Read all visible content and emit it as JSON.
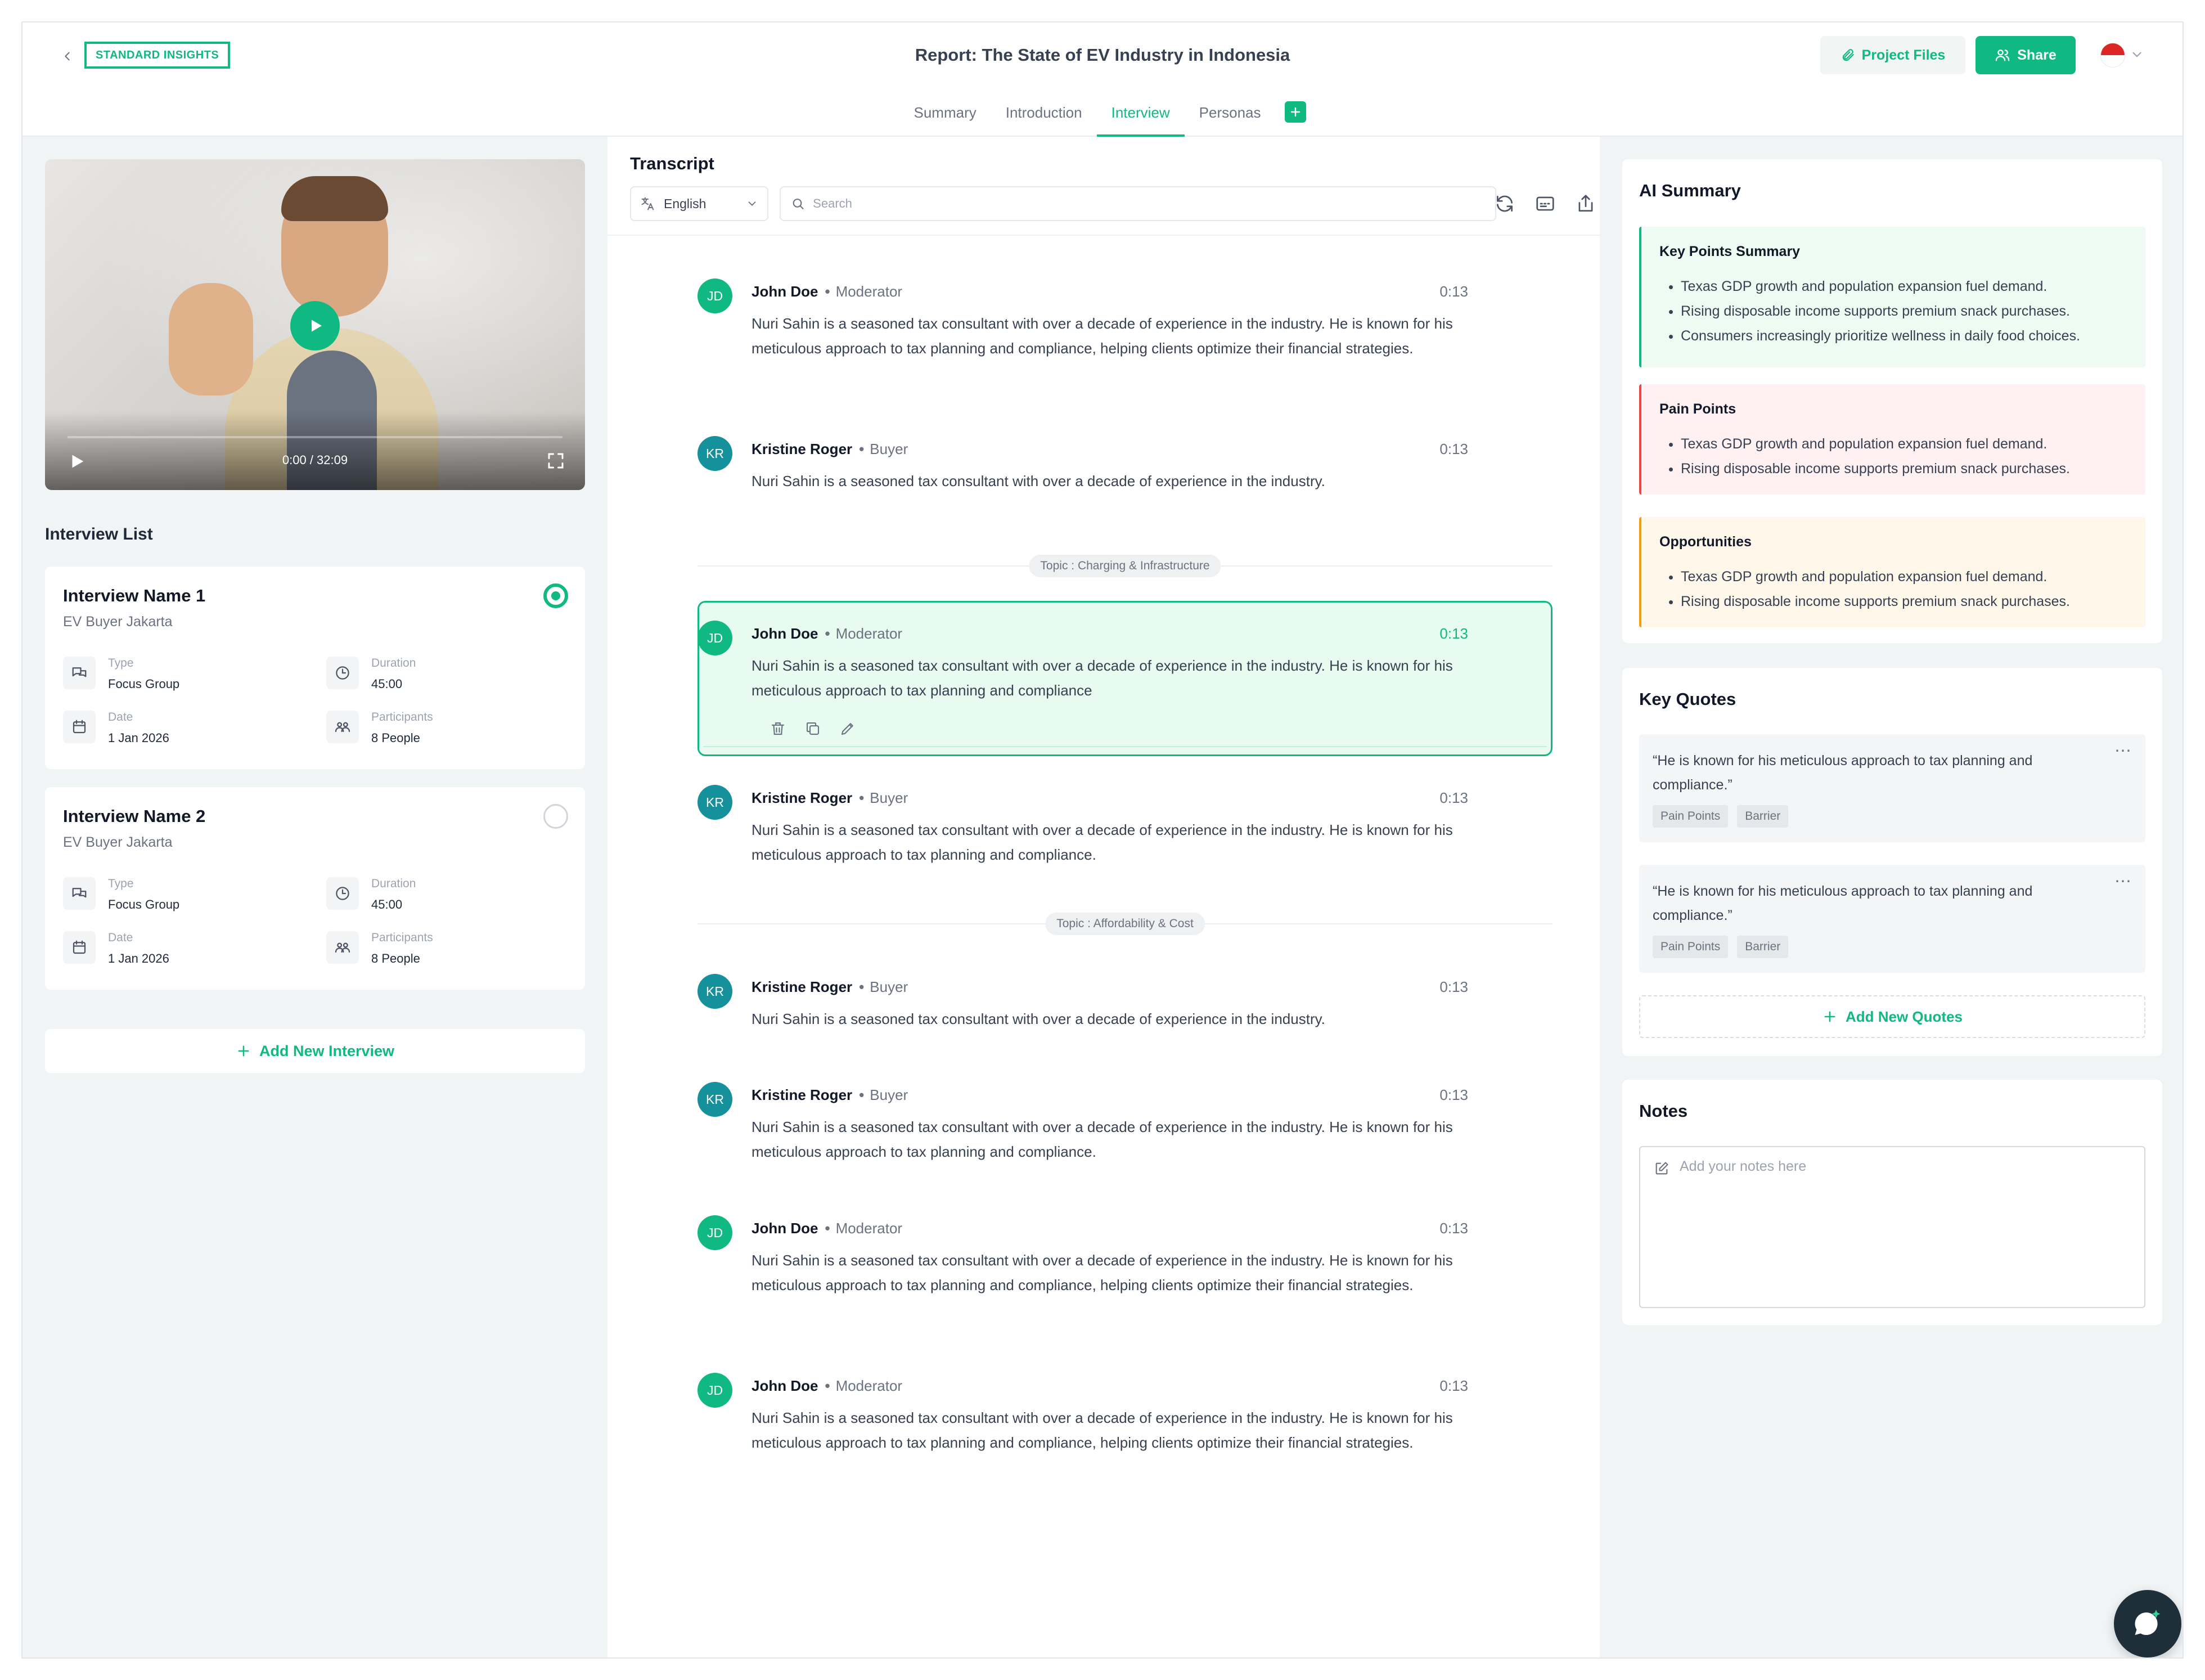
{
  "header": {
    "brand": "STANDARD INSIGHTS",
    "title": "Report: The State of EV Industry in Indonesia",
    "project_files": "Project Files",
    "share": "Share"
  },
  "tabs": [
    {
      "label": "Summary"
    },
    {
      "label": "Introduction"
    },
    {
      "label": "Interview",
      "active": true
    },
    {
      "label": "Personas"
    }
  ],
  "video": {
    "time": "0:00 / 32:09",
    "progress": 0
  },
  "interview_list": {
    "title": "Interview List",
    "items": [
      {
        "name": "Interview Name 1",
        "subtitle": "EV Buyer Jakarta",
        "selected": true,
        "type_label": "Type",
        "type": "Focus Group",
        "duration_label": "Duration",
        "duration": "45:00",
        "date_label": "Date",
        "date": "1 Jan 2026",
        "participants_label": "Participants",
        "participants": "8 People"
      },
      {
        "name": "Interview Name 2",
        "subtitle": "EV Buyer Jakarta",
        "selected": false,
        "type_label": "Type",
        "type": "Focus Group",
        "duration_label": "Duration",
        "duration": "45:00",
        "date_label": "Date",
        "date": "1 Jan 2026",
        "participants_label": "Participants",
        "participants": "8 People"
      }
    ],
    "add_label": "Add New Interview"
  },
  "transcript": {
    "title": "Transcript",
    "language": "English",
    "search_placeholder": "Search",
    "messages": [
      {
        "initials": "JD",
        "name": "John Doe",
        "role": "Moderator",
        "time": "0:13",
        "text": "Nuri Sahin is a seasoned tax consultant with over a decade of experience in the industry. He is known for his meticulous approach to tax planning and compliance, helping clients optimize their financial strategies."
      },
      {
        "initials": "KR",
        "name": "Kristine Roger",
        "role": "Buyer",
        "time": "0:13",
        "text": "Nuri Sahin is a seasoned tax consultant with over a decade of experience in the industry."
      },
      {
        "initials": "JD",
        "name": "John Doe",
        "role": "Moderator",
        "time": "0:13",
        "text": "Nuri Sahin is a seasoned tax consultant with over a decade of experience in the industry. He is known for his meticulous approach to tax planning and compliance"
      },
      {
        "initials": "KR",
        "name": "Kristine Roger",
        "role": "Buyer",
        "time": "0:13",
        "text": "Nuri Sahin is a seasoned tax consultant with over a decade of experience in the industry. He is known for his meticulous approach to tax planning and compliance."
      },
      {
        "initials": "KR",
        "name": "Kristine Roger",
        "role": "Buyer",
        "time": "0:13",
        "text": "Nuri Sahin is a seasoned tax consultant with over a decade of experience in the industry."
      },
      {
        "initials": "KR",
        "name": "Kristine Roger",
        "role": "Buyer",
        "time": "0:13",
        "text": "Nuri Sahin is a seasoned tax consultant with over a decade of experience in the industry. He is known for his meticulous approach to tax planning and compliance."
      },
      {
        "initials": "JD",
        "name": "John Doe",
        "role": "Moderator",
        "time": "0:13",
        "text": "Nuri Sahin is a seasoned tax consultant with over a decade of experience in the industry. He is known for his meticulous approach to tax planning and compliance, helping clients optimize their financial strategies."
      },
      {
        "initials": "JD",
        "name": "John Doe",
        "role": "Moderator",
        "time": "0:13",
        "text": "Nuri Sahin is a seasoned tax consultant with over a decade of experience in the industry. He is known for his meticulous approach to tax planning and compliance, helping clients optimize their financial strategies."
      }
    ],
    "topics": [
      "Topic : Charging & Infrastructure",
      "Topic : Affordability & Cost"
    ]
  },
  "ai_summary": {
    "title": "AI Summary",
    "key_points": {
      "title": "Key Points Summary",
      "items": [
        "Texas GDP growth and population expansion fuel demand.",
        "Rising disposable income supports premium snack purchases.",
        "Consumers increasingly prioritize wellness in daily food choices."
      ]
    },
    "pain_points": {
      "title": "Pain Points",
      "items": [
        "Texas GDP growth and population expansion fuel demand.",
        "Rising disposable income supports premium snack purchases."
      ]
    },
    "opportunities": {
      "title": "Opportunities",
      "items": [
        "Texas GDP growth and population expansion fuel demand.",
        "Rising disposable income supports premium snack purchases."
      ]
    }
  },
  "key_quotes": {
    "title": "Key Quotes",
    "items": [
      {
        "text": "“He is known for his meticulous approach to tax planning and compliance.”",
        "tags": [
          "Pain Points",
          "Barrier"
        ]
      },
      {
        "text": "“He is known for his meticulous approach to tax planning and compliance.”",
        "tags": [
          "Pain Points",
          "Barrier"
        ]
      }
    ],
    "add_label": "Add New Quotes",
    "more": "⋯"
  },
  "notes": {
    "title": "Notes",
    "placeholder": "Add your notes here"
  },
  "icons": {
    "back": "chevron-left-icon",
    "files": "paperclip-icon",
    "share": "users-icon",
    "play": "play-icon",
    "fullscreen": "fullscreen-icon",
    "type": "chat-icon",
    "duration": "clock-icon",
    "date": "calendar-icon",
    "participants": "people-icon",
    "translate": "translate-icon",
    "search": "search-icon",
    "refresh": "refresh-icon",
    "caption": "caption-icon",
    "export": "export-icon",
    "delete": "trash-icon",
    "copy": "copy-icon",
    "edit": "pencil-icon",
    "notes": "edit-note-icon",
    "assistant": "chat-sparkle-icon"
  },
  "colors": {
    "accent": "#10b981",
    "pain": "#ef4444",
    "opportunity": "#f59e0b",
    "kr_avatar": "#14919b"
  }
}
